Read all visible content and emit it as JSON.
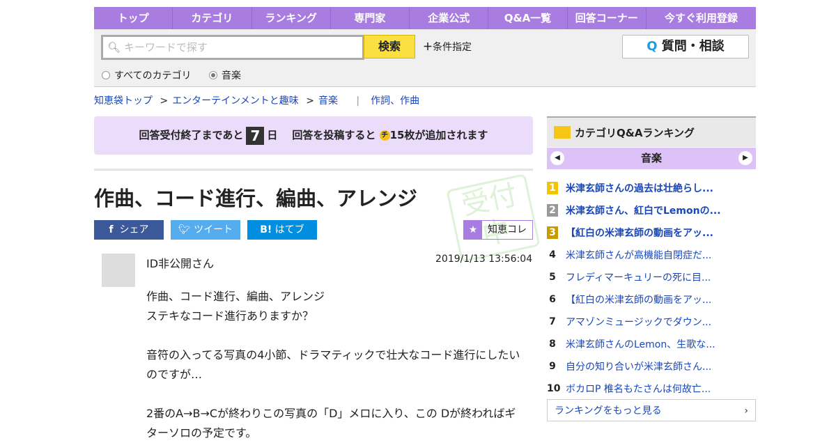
{
  "nav": [
    "トップ",
    "カテゴリ",
    "ランキング",
    "専門家",
    "企業公式",
    "Q&A一覧",
    "回答コーナー",
    "今すぐ利用登録"
  ],
  "search": {
    "placeholder": "キーワードで探す",
    "button": "検索",
    "conditions": "条件指定",
    "ask": "質問・相談",
    "radio_all": "すべてのカテゴリ",
    "radio_music": "音楽"
  },
  "breadcrumb": [
    "知恵袋トップ",
    "エンターテインメントと趣味",
    "音楽",
    "作詞、作曲"
  ],
  "notice": {
    "pre": "回答受付終了まであと",
    "days": "7",
    "day_unit": "日",
    "mid": "回答を投稿すると",
    "coin": "チ",
    "post": "15枚が追加されます"
  },
  "question": {
    "title": "作曲、コード進行、編曲、アレンジ",
    "share": "シェア",
    "tweet": "ツイート",
    "hatebu": "はてブ",
    "kore": "知恵コレ",
    "stamp": "受付中",
    "user": "ID非公開さん",
    "date": "2019/1/13  13:56:04",
    "lines": [
      "作曲、コード進行、編曲、アレンジ",
      "ステキなコード進行ありますか？",
      "",
      "音符の入ってる写真の4小節、ドラマティックで壮大なコード進行にしたいのですが…",
      "",
      "2番のA→B→Cが終わりこの写真の「D」メロに入り、この Dが終わればギターソロの予定です。"
    ]
  },
  "ranking": {
    "title": "カテゴリQ&Aランキング",
    "category": "音楽",
    "more": "ランキングをもっと見る",
    "items": [
      {
        "n": "1",
        "t": "米津玄師さんの過去は壮絶らし..."
      },
      {
        "n": "2",
        "t": "米津玄師さん、紅白でLemonの..."
      },
      {
        "n": "3",
        "t": "【紅白の米津玄師の動画をアッ..."
      },
      {
        "n": "4",
        "t": "米津玄師さんが高機能自閉症だ..."
      },
      {
        "n": "5",
        "t": "フレディマーキュリーの死に目..."
      },
      {
        "n": "6",
        "t": "【紅白の米津玄師の動画をアッ..."
      },
      {
        "n": "7",
        "t": "アマゾンミュージックでダウン..."
      },
      {
        "n": "8",
        "t": "米津玄師さんのLemon、生歌な..."
      },
      {
        "n": "9",
        "t": "自分の知り合いが米津玄師さん..."
      },
      {
        "n": "10",
        "t": "ボカロP 椎名もたさんは何故亡..."
      }
    ]
  }
}
